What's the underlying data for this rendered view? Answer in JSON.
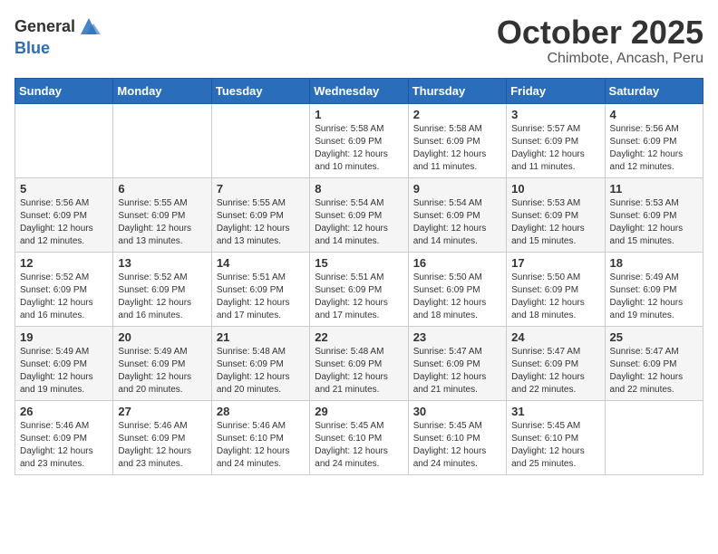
{
  "header": {
    "logo_general": "General",
    "logo_blue": "Blue",
    "month": "October 2025",
    "location": "Chimbote, Ancash, Peru"
  },
  "weekdays": [
    "Sunday",
    "Monday",
    "Tuesday",
    "Wednesday",
    "Thursday",
    "Friday",
    "Saturday"
  ],
  "weeks": [
    [
      {
        "day": "",
        "info": ""
      },
      {
        "day": "",
        "info": ""
      },
      {
        "day": "",
        "info": ""
      },
      {
        "day": "1",
        "info": "Sunrise: 5:58 AM\nSunset: 6:09 PM\nDaylight: 12 hours and 10 minutes."
      },
      {
        "day": "2",
        "info": "Sunrise: 5:58 AM\nSunset: 6:09 PM\nDaylight: 12 hours and 11 minutes."
      },
      {
        "day": "3",
        "info": "Sunrise: 5:57 AM\nSunset: 6:09 PM\nDaylight: 12 hours and 11 minutes."
      },
      {
        "day": "4",
        "info": "Sunrise: 5:56 AM\nSunset: 6:09 PM\nDaylight: 12 hours and 12 minutes."
      }
    ],
    [
      {
        "day": "5",
        "info": "Sunrise: 5:56 AM\nSunset: 6:09 PM\nDaylight: 12 hours and 12 minutes."
      },
      {
        "day": "6",
        "info": "Sunrise: 5:55 AM\nSunset: 6:09 PM\nDaylight: 12 hours and 13 minutes."
      },
      {
        "day": "7",
        "info": "Sunrise: 5:55 AM\nSunset: 6:09 PM\nDaylight: 12 hours and 13 minutes."
      },
      {
        "day": "8",
        "info": "Sunrise: 5:54 AM\nSunset: 6:09 PM\nDaylight: 12 hours and 14 minutes."
      },
      {
        "day": "9",
        "info": "Sunrise: 5:54 AM\nSunset: 6:09 PM\nDaylight: 12 hours and 14 minutes."
      },
      {
        "day": "10",
        "info": "Sunrise: 5:53 AM\nSunset: 6:09 PM\nDaylight: 12 hours and 15 minutes."
      },
      {
        "day": "11",
        "info": "Sunrise: 5:53 AM\nSunset: 6:09 PM\nDaylight: 12 hours and 15 minutes."
      }
    ],
    [
      {
        "day": "12",
        "info": "Sunrise: 5:52 AM\nSunset: 6:09 PM\nDaylight: 12 hours and 16 minutes."
      },
      {
        "day": "13",
        "info": "Sunrise: 5:52 AM\nSunset: 6:09 PM\nDaylight: 12 hours and 16 minutes."
      },
      {
        "day": "14",
        "info": "Sunrise: 5:51 AM\nSunset: 6:09 PM\nDaylight: 12 hours and 17 minutes."
      },
      {
        "day": "15",
        "info": "Sunrise: 5:51 AM\nSunset: 6:09 PM\nDaylight: 12 hours and 17 minutes."
      },
      {
        "day": "16",
        "info": "Sunrise: 5:50 AM\nSunset: 6:09 PM\nDaylight: 12 hours and 18 minutes."
      },
      {
        "day": "17",
        "info": "Sunrise: 5:50 AM\nSunset: 6:09 PM\nDaylight: 12 hours and 18 minutes."
      },
      {
        "day": "18",
        "info": "Sunrise: 5:49 AM\nSunset: 6:09 PM\nDaylight: 12 hours and 19 minutes."
      }
    ],
    [
      {
        "day": "19",
        "info": "Sunrise: 5:49 AM\nSunset: 6:09 PM\nDaylight: 12 hours and 19 minutes."
      },
      {
        "day": "20",
        "info": "Sunrise: 5:49 AM\nSunset: 6:09 PM\nDaylight: 12 hours and 20 minutes."
      },
      {
        "day": "21",
        "info": "Sunrise: 5:48 AM\nSunset: 6:09 PM\nDaylight: 12 hours and 20 minutes."
      },
      {
        "day": "22",
        "info": "Sunrise: 5:48 AM\nSunset: 6:09 PM\nDaylight: 12 hours and 21 minutes."
      },
      {
        "day": "23",
        "info": "Sunrise: 5:47 AM\nSunset: 6:09 PM\nDaylight: 12 hours and 21 minutes."
      },
      {
        "day": "24",
        "info": "Sunrise: 5:47 AM\nSunset: 6:09 PM\nDaylight: 12 hours and 22 minutes."
      },
      {
        "day": "25",
        "info": "Sunrise: 5:47 AM\nSunset: 6:09 PM\nDaylight: 12 hours and 22 minutes."
      }
    ],
    [
      {
        "day": "26",
        "info": "Sunrise: 5:46 AM\nSunset: 6:09 PM\nDaylight: 12 hours and 23 minutes."
      },
      {
        "day": "27",
        "info": "Sunrise: 5:46 AM\nSunset: 6:09 PM\nDaylight: 12 hours and 23 minutes."
      },
      {
        "day": "28",
        "info": "Sunrise: 5:46 AM\nSunset: 6:10 PM\nDaylight: 12 hours and 24 minutes."
      },
      {
        "day": "29",
        "info": "Sunrise: 5:45 AM\nSunset: 6:10 PM\nDaylight: 12 hours and 24 minutes."
      },
      {
        "day": "30",
        "info": "Sunrise: 5:45 AM\nSunset: 6:10 PM\nDaylight: 12 hours and 24 minutes."
      },
      {
        "day": "31",
        "info": "Sunrise: 5:45 AM\nSunset: 6:10 PM\nDaylight: 12 hours and 25 minutes."
      },
      {
        "day": "",
        "info": ""
      }
    ]
  ]
}
